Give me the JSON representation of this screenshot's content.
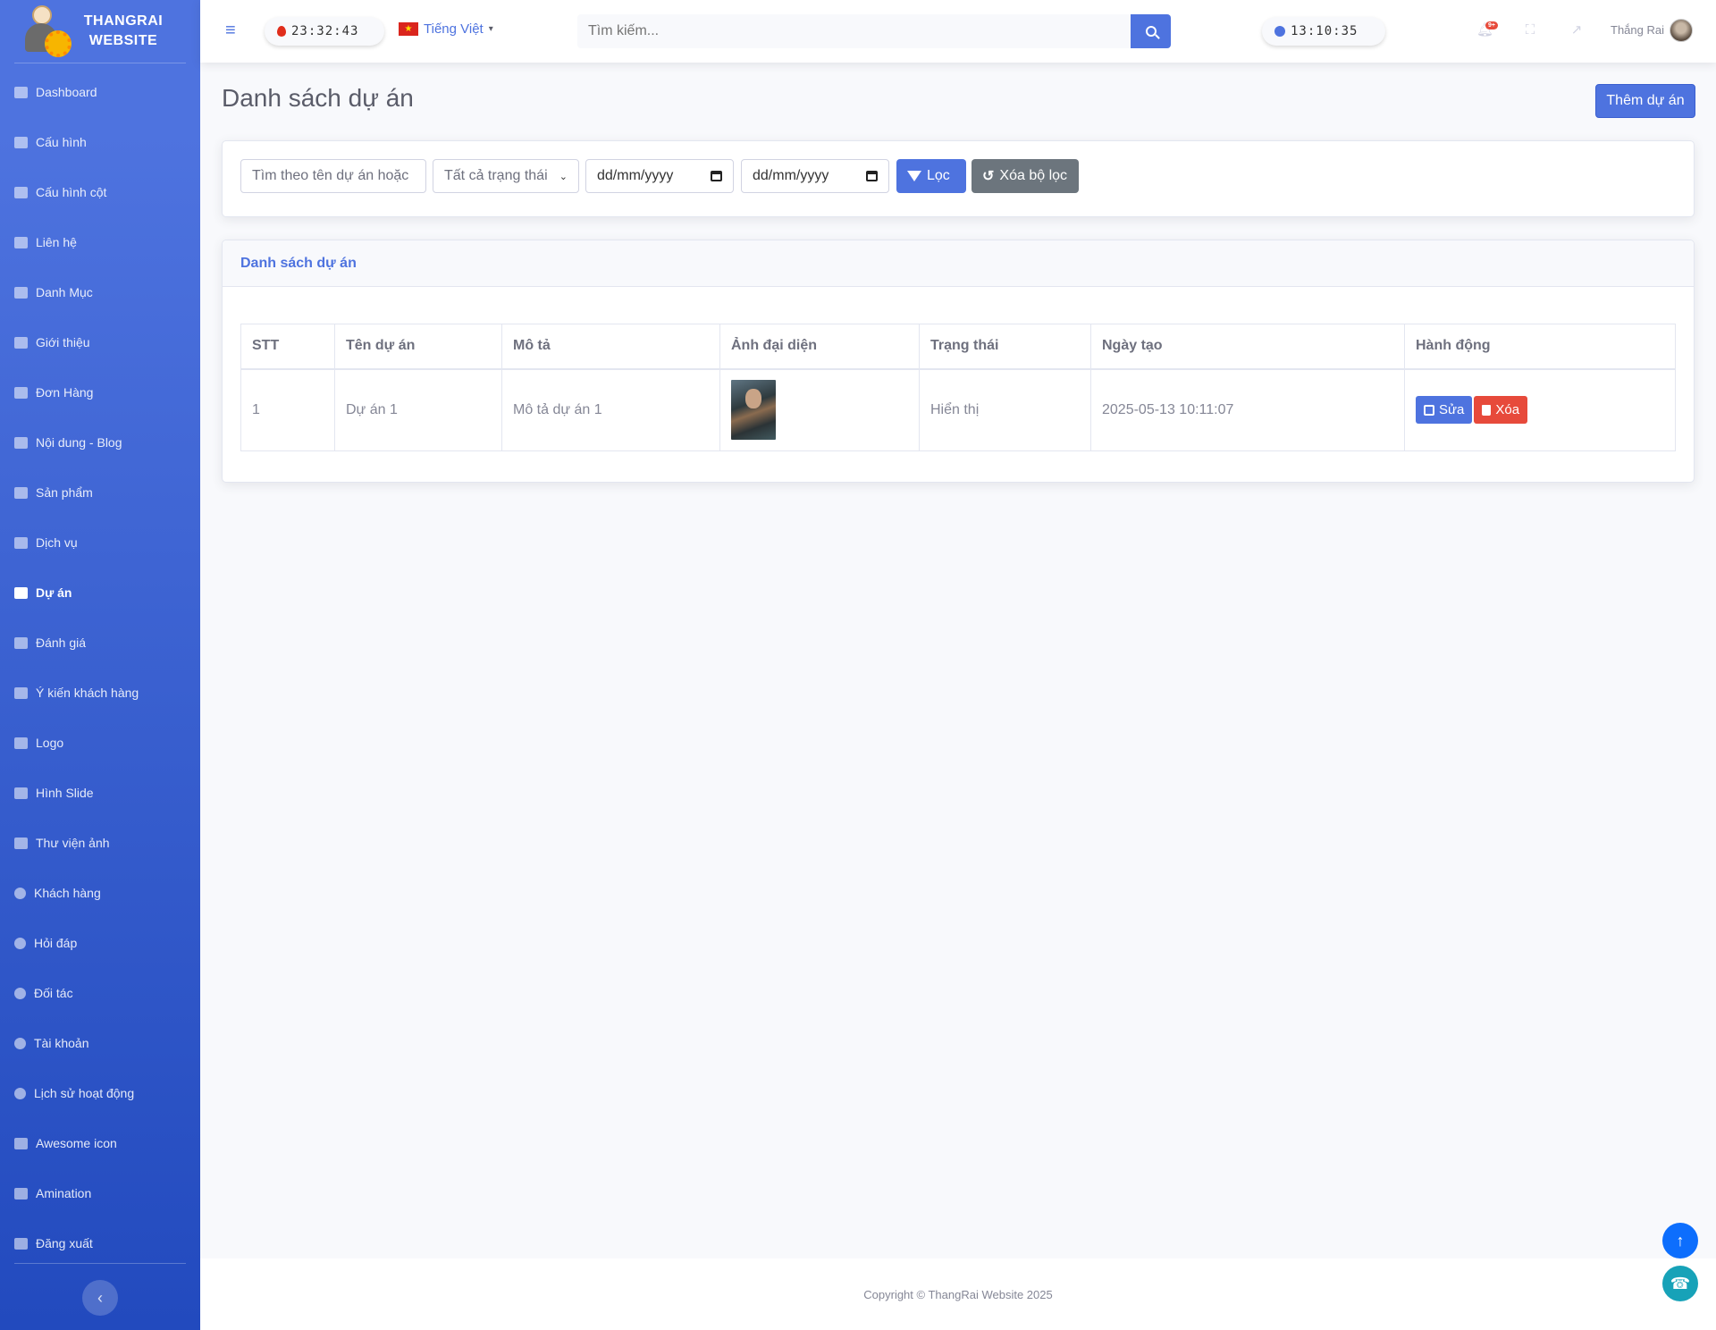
{
  "brand": {
    "line1": "THANGRAI",
    "line2": "WEBSITE"
  },
  "sidebar": {
    "items": [
      {
        "label": "Dashboard",
        "icon": "tachometer-icon"
      },
      {
        "label": "Cấu hình",
        "icon": "cogs-icon"
      },
      {
        "label": "Cấu hình cột",
        "icon": "table-icon"
      },
      {
        "label": "Liên hệ",
        "icon": "envelope-icon"
      },
      {
        "label": "Danh Mục",
        "icon": "tags-icon"
      },
      {
        "label": "Giới thiệu",
        "icon": "file-icon"
      },
      {
        "label": "Đơn Hàng",
        "icon": "cart-icon"
      },
      {
        "label": "Nội dung - Blog",
        "icon": "book-icon"
      },
      {
        "label": "Sản phẩm",
        "icon": "box-icon"
      },
      {
        "label": "Dịch vụ",
        "icon": "concierge-icon"
      },
      {
        "label": "Dự án",
        "icon": "folder-icon",
        "active": true
      },
      {
        "label": "Đánh giá",
        "icon": "star-icon"
      },
      {
        "label": "Ý kiến khách hàng",
        "icon": "comments-icon"
      },
      {
        "label": "Logo",
        "icon": "images-icon"
      },
      {
        "label": "Hình Slide",
        "icon": "images-icon"
      },
      {
        "label": "Thư viện ảnh",
        "icon": "image-icon"
      },
      {
        "label": "Khách hàng",
        "icon": "users-icon"
      },
      {
        "label": "Hỏi đáp",
        "icon": "question-circle-icon"
      },
      {
        "label": "Đối tác",
        "icon": "user-friends-icon"
      },
      {
        "label": "Tài khoản",
        "icon": "user-cog-icon"
      },
      {
        "label": "Lịch sử hoạt động",
        "icon": "history-icon"
      },
      {
        "label": "Awesome icon",
        "icon": "list-icon"
      },
      {
        "label": "Amination",
        "icon": "film-icon"
      },
      {
        "label": "Đăng xuất",
        "icon": "sign-out-icon"
      }
    ]
  },
  "topbar": {
    "clock_left": "23:32:43",
    "language": "Tiếng Việt",
    "search_placeholder": "Tìm kiếm...",
    "clock_right": "13:10:35",
    "notification_badge": "9+",
    "user_name": "Thắng Rai"
  },
  "page": {
    "title": "Danh sách dự án",
    "add_button": "Thêm dự án"
  },
  "filters": {
    "name_placeholder": "Tìm theo tên dự án hoặc",
    "status_selected": "Tất cả trạng thái",
    "date_from": "dd/mm/yyyy",
    "date_to": "dd/mm/yyyy",
    "filter_button": "Lọc",
    "clear_button": "Xóa bộ lọc"
  },
  "list": {
    "header": "Danh sách dự án",
    "columns": [
      "STT",
      "Tên dự án",
      "Mô tả",
      "Ảnh đại diện",
      "Trạng thái",
      "Ngày tạo",
      "Hành động"
    ],
    "rows": [
      {
        "stt": "1",
        "name": "Dự án 1",
        "description": "Mô tả dự án 1",
        "status": "Hiển thị",
        "created": "2025-05-13 10:11:07",
        "edit": "Sửa",
        "delete": "Xóa"
      }
    ]
  },
  "footer": {
    "copyright": "Copyright © ThangRai Website 2025"
  }
}
